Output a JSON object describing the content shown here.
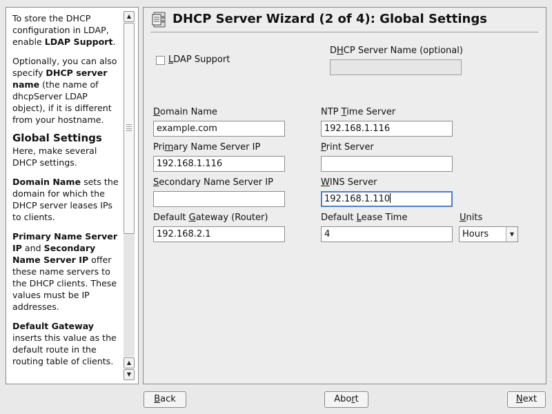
{
  "help": {
    "p1_a": "To store the DHCP configuration in LDAP, enable ",
    "p1_b": "LDAP Support",
    "p1_c": ".",
    "p2_a": "Optionally, you can also specify ",
    "p2_b": "DHCP server name",
    "p2_c": " (the name of dhcpServer LDAP object), if it is different from your hostname.",
    "heading": "Global Settings",
    "p3": "Here, make several DHCP settings.",
    "p4_a": "Domain Name",
    "p4_b": " sets the domain for which the DHCP server leases IPs to clients.",
    "p5_a": "Primary Name Server IP",
    "p5_b": " and ",
    "p5_c": "Secondary Name Server IP",
    "p5_d": " offer these name servers to the DHCP clients. These values must be IP addresses.",
    "p6_a": "Default Gateway",
    "p6_b": " inserts this value as the default route in the routing table of clients."
  },
  "title": "DHCP Server Wizard (2 of 4): Global Settings",
  "ldap": {
    "pre": "",
    "key": "L",
    "post": "DAP Support",
    "checked": false
  },
  "server_name": {
    "pre": "D",
    "key": "H",
    "post": "CP Server Name (optional)",
    "value": ""
  },
  "domain": {
    "pre": "",
    "key": "D",
    "post": "omain Name",
    "value": "example.com"
  },
  "ntp": {
    "pre": "NTP ",
    "key": "T",
    "post": "ime Server",
    "value": "192.168.1.116"
  },
  "primary": {
    "pre": "Pri",
    "key": "m",
    "post": "ary Name Server IP",
    "value": "192.168.1.116"
  },
  "print": {
    "pre": "",
    "key": "P",
    "post": "rint Server",
    "value": ""
  },
  "secondary": {
    "pre": "",
    "key": "S",
    "post": "econdary Name Server IP",
    "value": ""
  },
  "wins": {
    "pre": "",
    "key": "W",
    "post": "INS Server",
    "value": "192.168.1.110"
  },
  "gateway": {
    "pre": "Default ",
    "key": "G",
    "post": "ateway (Router)",
    "value": "192.168.2.1"
  },
  "lease": {
    "pre": "Default ",
    "key": "L",
    "post": "ease Time",
    "value": "4"
  },
  "units": {
    "pre": "",
    "key": "U",
    "post": "nits",
    "value": "Hours"
  },
  "buttons": {
    "back": {
      "pre": "",
      "key": "B",
      "post": "ack"
    },
    "abort": {
      "pre": "Abo",
      "key": "r",
      "post": "t"
    },
    "next": {
      "pre": "",
      "key": "N",
      "post": "ext"
    }
  },
  "icons": {
    "scroll_up": "arrow-up-icon",
    "scroll_down": "arrow-down-icon",
    "wizard": "wizard-icon",
    "dropdown": "chevron-down-icon"
  }
}
